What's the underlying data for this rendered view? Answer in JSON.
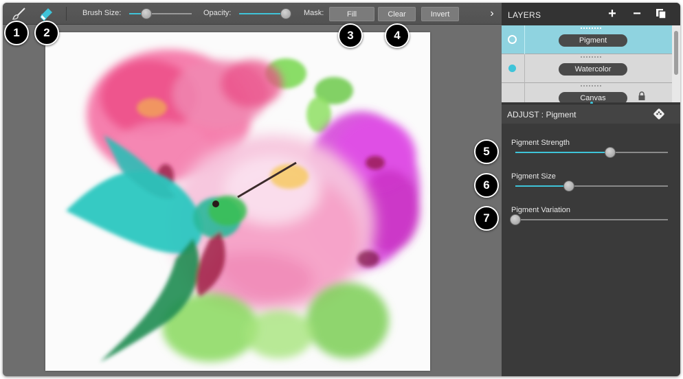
{
  "toolbar": {
    "brush_tool_icon": "paintbrush-icon",
    "eraser_tool_icon": "eraser-icon",
    "brush_size_label": "Brush Size:",
    "brush_size_value": 0.27,
    "opacity_label": "Opacity:",
    "opacity_value": 1.0,
    "mask_label": "Mask:",
    "fill_button": "Fill",
    "clear_button": "Clear",
    "invert_button": "Invert",
    "expand_icon": "chevron-right-icon"
  },
  "callouts": [
    "1",
    "2",
    "3",
    "4",
    "5",
    "6",
    "7"
  ],
  "layers": {
    "title": "LAYERS",
    "add_icon": "plus-icon",
    "remove_icon": "minus-icon",
    "duplicate_icon": "duplicate-icon",
    "items": [
      {
        "label": "Pigment",
        "selected": true
      },
      {
        "label": "Watercolor",
        "selected": false
      },
      {
        "label": "Canvas",
        "selected": false,
        "locked": true
      }
    ]
  },
  "adjust": {
    "title": "ADJUST : Pigment",
    "randomize_icon": "dice-icon",
    "sliders": [
      {
        "label": "Pigment Strength",
        "value": 0.62
      },
      {
        "label": "Pigment Size",
        "value": 0.35
      },
      {
        "label": "Pigment Variation",
        "value": 0.0
      }
    ]
  },
  "colors": {
    "accent": "#3fc4d9",
    "selected_layer": "#8fd3e0",
    "workspace": "#6e6e6e",
    "panel": "#3a3a3a"
  }
}
